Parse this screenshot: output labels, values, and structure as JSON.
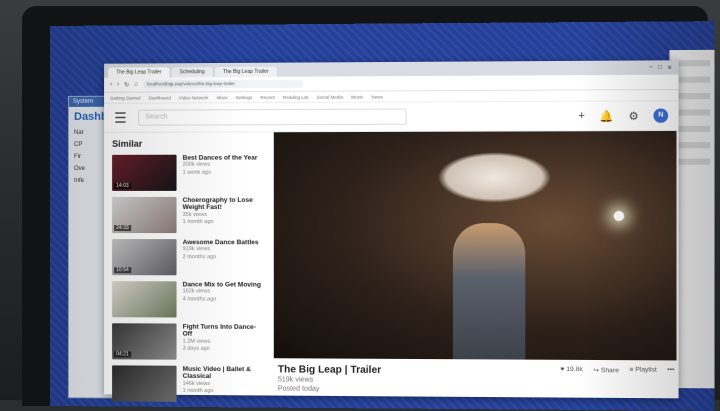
{
  "background_dashboard": {
    "window_label": "System",
    "title": "Dashb",
    "rows": [
      "Nar",
      "CP",
      "Fir",
      "Ove",
      "Infe"
    ]
  },
  "browser": {
    "tabs": [
      "The Big Leap Trailer",
      "Scheduling",
      "The Big Leap Trailer"
    ],
    "url": "localhost/bigLeap/videos/the-big-leap-trailer",
    "bookmarks": [
      "Getting Started",
      "Dashboard",
      "Video Network",
      "Inbox",
      "Settings",
      "Recent",
      "Reading List",
      "Social Media",
      "Music",
      "News"
    ],
    "window_controls": [
      "–",
      "□",
      "✕"
    ]
  },
  "app": {
    "search_placeholder": "Search",
    "avatar_initial": "N",
    "icons": [
      "menu-icon",
      "plus-icon",
      "bell-icon",
      "gear-icon"
    ],
    "sidebar_title": "Similar",
    "similar": [
      {
        "title": "Best Dances of the Year",
        "views": "200k views",
        "age": "1 week ago",
        "duration": "14:03"
      },
      {
        "title": "Choerography to Lose Weight Fast!",
        "views": "35k views",
        "age": "1 month ago",
        "duration": "24:33"
      },
      {
        "title": "Awesome Dance Battles",
        "views": "919k views",
        "age": "2 months ago",
        "duration": "10:54"
      },
      {
        "title": "Dance Mix to Get Moving",
        "views": "162k views",
        "age": "4 months ago",
        "duration": ""
      },
      {
        "title": "Fight Turns Into Dance-Off",
        "views": "1.2M views",
        "age": "3 days ago",
        "duration": "04:21"
      },
      {
        "title": "Music Video | Ballet & Classical",
        "views": "146k views",
        "age": "1 month ago",
        "duration": ""
      }
    ],
    "video": {
      "title": "The Big Leap | Trailer",
      "views": "519k views",
      "posted": "Posted today",
      "likes": "19.8k",
      "share": "Share",
      "playlist": "Playlist",
      "more": "•••"
    }
  }
}
